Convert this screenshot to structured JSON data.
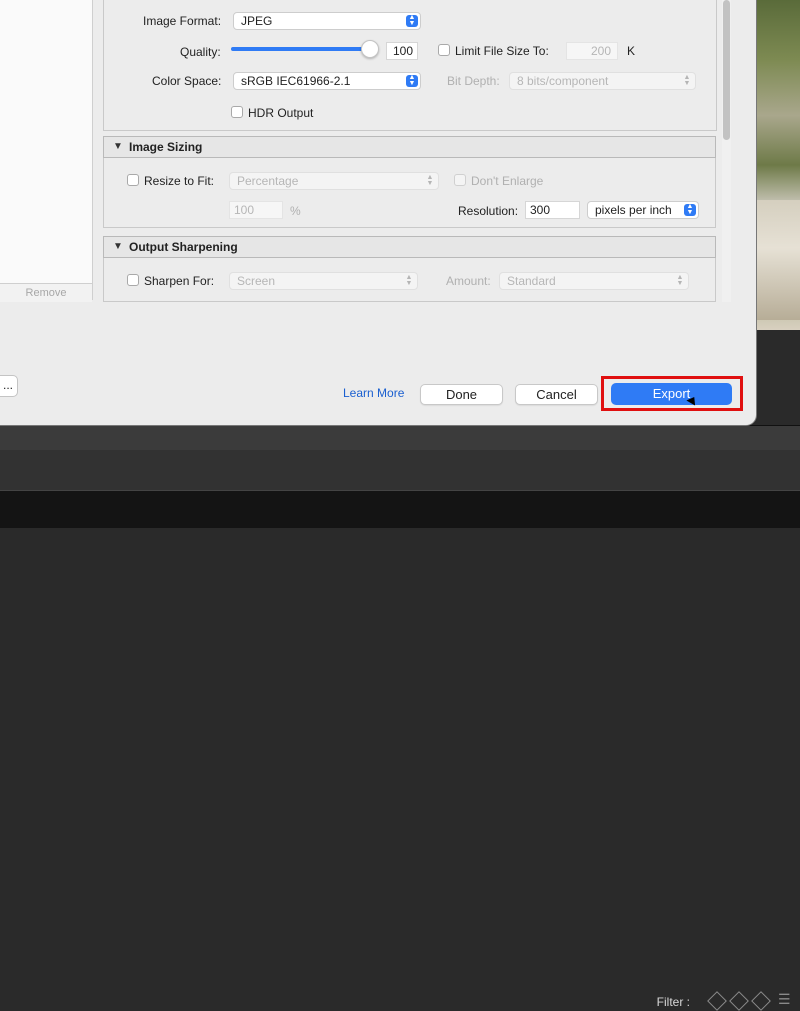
{
  "format_section": {
    "image_format_label": "Image Format:",
    "image_format_value": "JPEG",
    "quality_label": "Quality:",
    "quality_value": "100",
    "quality_fraction": 1.0,
    "limit_file_size_label": "Limit File Size To:",
    "limit_file_size_value": "200",
    "limit_file_size_unit": "K",
    "color_space_label": "Color Space:",
    "color_space_value": "sRGB IEC61966-2.1",
    "bit_depth_label": "Bit Depth:",
    "bit_depth_value": "8 bits/component",
    "hdr_output_label": "HDR Output"
  },
  "image_sizing": {
    "title": "Image Sizing",
    "resize_to_fit_label": "Resize to Fit:",
    "resize_mode_value": "Percentage",
    "dont_enlarge_label": "Don't Enlarge",
    "percent_value": "100",
    "percent_unit": "%",
    "resolution_label": "Resolution:",
    "resolution_value": "300",
    "resolution_unit": "pixels per inch"
  },
  "output_sharpening": {
    "title": "Output Sharpening",
    "sharpen_for_label": "Sharpen For:",
    "sharpen_for_value": "Screen",
    "amount_label": "Amount:",
    "amount_value": "Standard"
  },
  "left_panel": {
    "remove_label": "Remove",
    "ellipsis_label": "..."
  },
  "footer": {
    "learn_more_label": "Learn More",
    "done_label": "Done",
    "cancel_label": "Cancel",
    "export_label": "Export"
  },
  "filmstrip": {
    "filter_label": "Filter :"
  },
  "colors": {
    "accent": "#2f7bf5",
    "highlight": "#e01010",
    "link": "#1a5fd0"
  }
}
